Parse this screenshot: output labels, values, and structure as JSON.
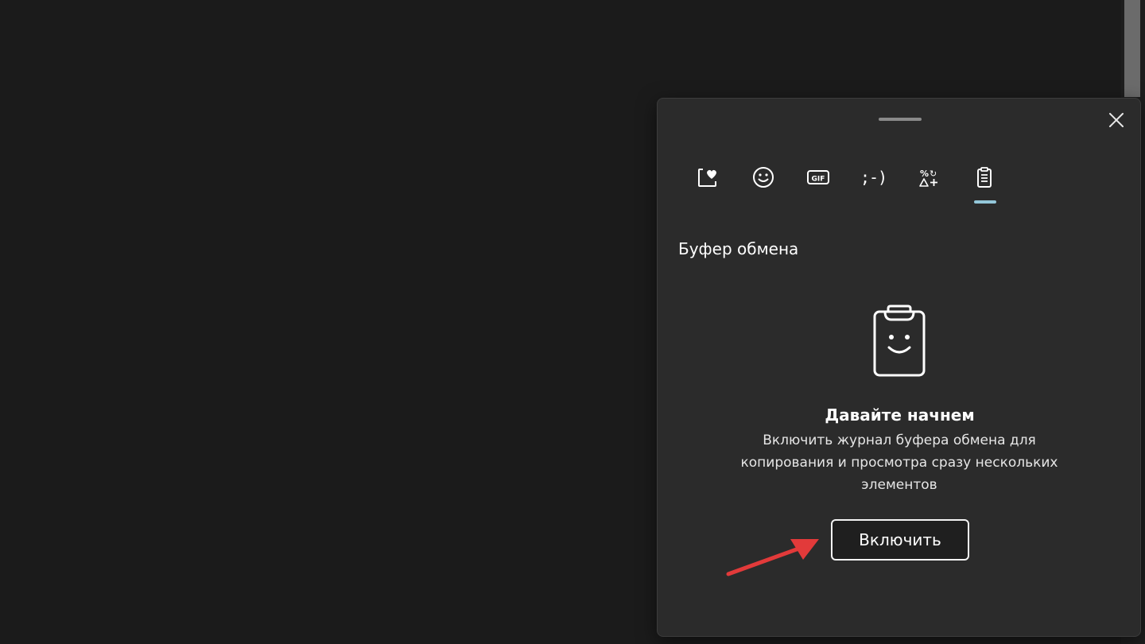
{
  "panel": {
    "close_icon": "close-icon",
    "tabs": [
      {
        "name": "favorites-tab",
        "icon": "heart-clipboard-icon",
        "selected": false
      },
      {
        "name": "emoji-tab",
        "icon": "smiley-icon",
        "selected": false
      },
      {
        "name": "gif-tab",
        "icon": "gif-icon",
        "selected": false,
        "glyph": "GIF"
      },
      {
        "name": "kaomoji-tab",
        "icon": "kaomoji-icon",
        "selected": false,
        "glyph": ";-)"
      },
      {
        "name": "symbols-tab",
        "icon": "symbols-icon",
        "selected": false
      },
      {
        "name": "clipboard-tab",
        "icon": "clipboard-icon",
        "selected": true
      }
    ],
    "section_title": "Буфер обмена",
    "empty_state": {
      "icon": "smiling-clipboard-icon",
      "heading": "Давайте начнем",
      "description": "Включить журнал буфера обмена для копирования и просмотра сразу нескольких элементов",
      "button_label": "Включить"
    }
  },
  "annotation": {
    "arrow_color": "#e23a3a"
  },
  "colors": {
    "background": "#1b1b1b",
    "panel": "#2b2b2b",
    "accent": "#93c7d9"
  }
}
